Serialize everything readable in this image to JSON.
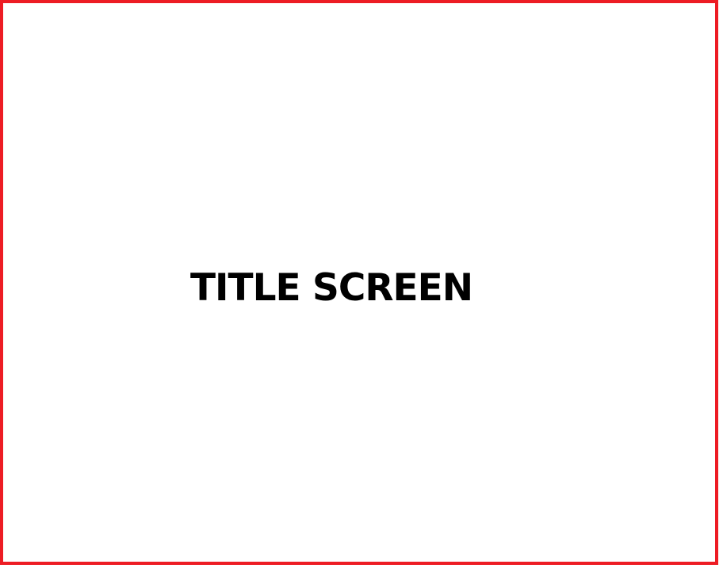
{
  "screen": {
    "title": "TITLE SCREEN"
  },
  "colors": {
    "border": "#ed1c24",
    "background": "#ffffff",
    "text": "#000000"
  }
}
